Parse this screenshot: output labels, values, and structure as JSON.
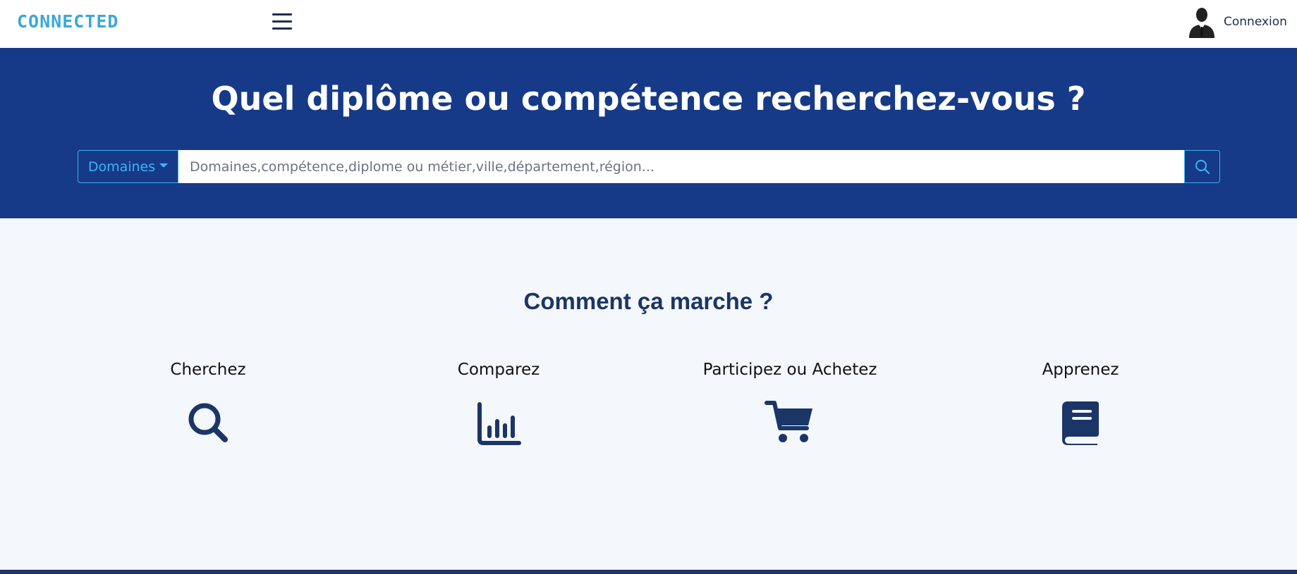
{
  "header": {
    "logo_text": "CONNECTED",
    "login_label": "Connexion"
  },
  "hero": {
    "title": "Quel diplôme ou compétence recherchez-vous ?",
    "domains_label": "Domaines",
    "search_placeholder": "Domaines,compétence,diplome ou métier,ville,département,région..."
  },
  "how_it_works": {
    "title": "Comment ça marche ?",
    "steps": [
      {
        "label": "Cherchez",
        "icon": "search-icon"
      },
      {
        "label": "Comparez",
        "icon": "bar-chart-icon"
      },
      {
        "label": "Participez ou Achetez",
        "icon": "shopping-cart-icon"
      },
      {
        "label": "Apprenez",
        "icon": "book-icon"
      }
    ]
  },
  "colors": {
    "brand_logo": "#3aa8d8",
    "hero_background": "#163a88",
    "accent_border": "#3bb0f0",
    "section_background": "#f4f7fc",
    "icon_dark": "#1b3566"
  }
}
